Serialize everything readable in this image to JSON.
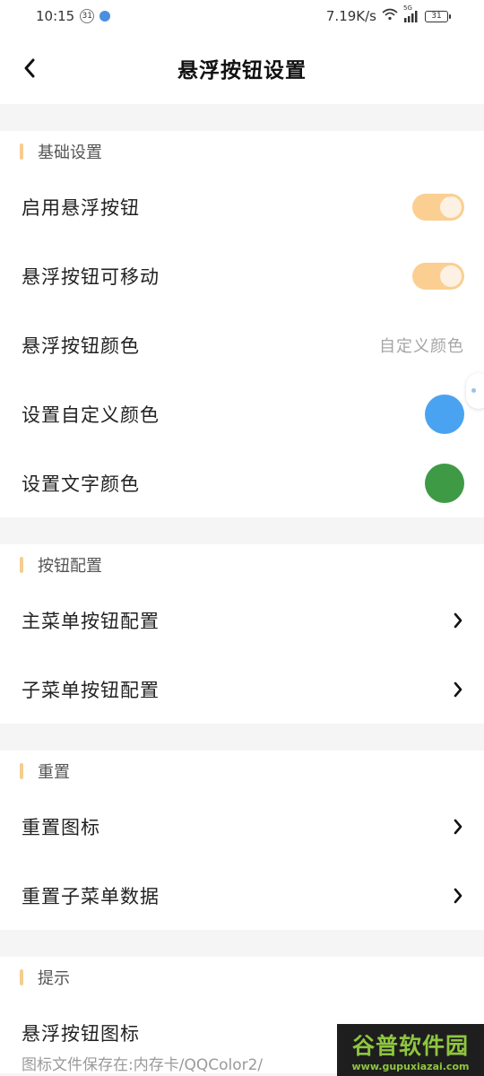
{
  "status_bar": {
    "time": "10:15",
    "badge": "31",
    "net_speed": "7.19K/s",
    "signal": "5G",
    "battery": "31"
  },
  "header": {
    "title": "悬浮按钮设置"
  },
  "sections": {
    "basic": {
      "title": "基础设置",
      "enable_label": "启用悬浮按钮",
      "enable_on": true,
      "movable_label": "悬浮按钮可移动",
      "movable_on": true,
      "color_label": "悬浮按钮颜色",
      "color_value": "自定义颜色",
      "custom_color_label": "设置自定义颜色",
      "custom_color": "#4aa3f0",
      "text_color_label": "设置文字颜色",
      "text_color": "#3f9a45"
    },
    "buttons": {
      "title": "按钮配置",
      "main_menu_label": "主菜单按钮配置",
      "sub_menu_label": "子菜单按钮配置"
    },
    "reset": {
      "title": "重置",
      "reset_icon_label": "重置图标",
      "reset_sub_label": "重置子菜单数据"
    },
    "tips": {
      "title": "提示",
      "icon_label": "悬浮按钮图标",
      "icon_path": "图标文件保存在:内存卡/QQColor2/"
    }
  },
  "watermark": {
    "main": "谷普软件园",
    "sub": "www.gupuxiazai.com"
  },
  "colors": {
    "accent": "#fbcf91",
    "section_bar": "#f6cd8f"
  }
}
